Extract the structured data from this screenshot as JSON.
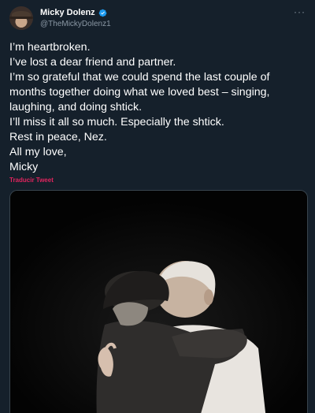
{
  "author": {
    "display_name": "Micky Dolenz",
    "handle": "@TheMickyDolenz1",
    "verified_badge_icon": "verified-badge-icon",
    "avatar_icon": "avatar-cowboy-hat"
  },
  "more_menu": {
    "label": "···",
    "icon": "more-horizontal-icon"
  },
  "tweet": {
    "lines": [
      "I’m heartbroken.",
      "I’ve lost a dear friend and partner.",
      "I’m so grateful that we could spend the last couple of",
      "months together doing what we loved best – singing,",
      "laughing, and doing shtick.",
      "I’ll miss it all so much.  Especially the shtick.",
      "Rest in peace, Nez.",
      "All my love,",
      "Micky"
    ],
    "translate_label": "Traducir Tweet"
  },
  "media": {
    "description_icon": "photo-two-men-embracing"
  },
  "colors": {
    "background": "#15202b",
    "text_primary": "#ffffff",
    "text_secondary": "#8b98a5",
    "verified_blue": "#1d9bf0",
    "translate_link": "#e0245e",
    "media_border": "#38444d"
  }
}
